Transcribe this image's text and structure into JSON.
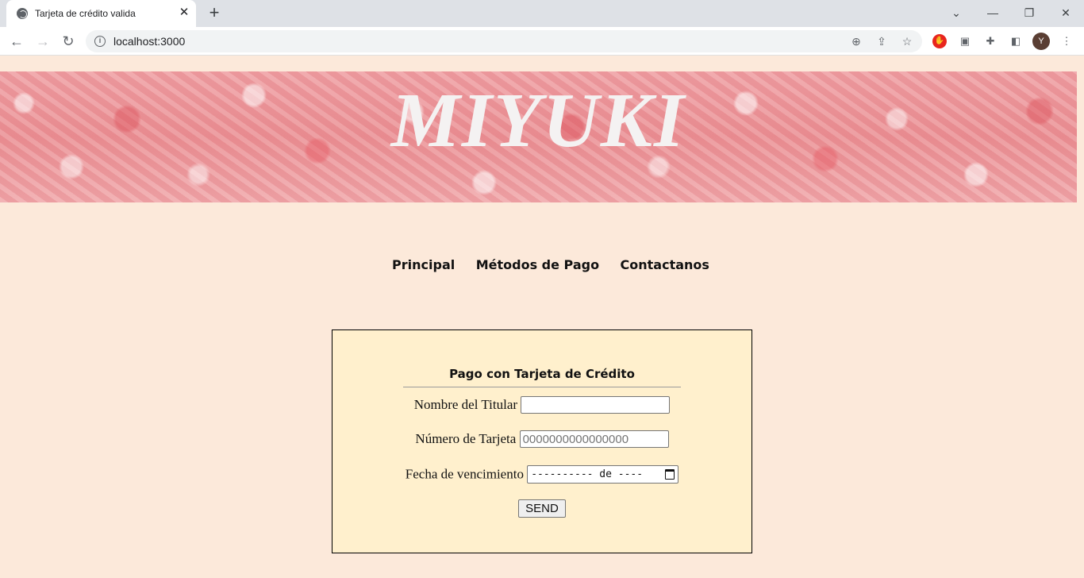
{
  "browser": {
    "tab_title": "Tarjeta de crédito valida",
    "url": "localhost:3000",
    "avatar_letter": "Y"
  },
  "banner": {
    "title": "MIYUKI",
    "accent": "#eb9296"
  },
  "nav": {
    "items": [
      "Principal",
      "Métodos de Pago",
      "Contactanos"
    ]
  },
  "form": {
    "title": "Pago con Tarjeta de Crédito",
    "holder_label": "Nombre del Titular",
    "holder_value": "",
    "card_label": "Número de Tarjeta",
    "card_placeholder": "0000000000000000",
    "date_label": "Fecha de vencimiento",
    "date_placeholder": "---------- de ----",
    "submit_label": "SEND",
    "background": "#fff0cd"
  },
  "page_background": "#fce9da"
}
